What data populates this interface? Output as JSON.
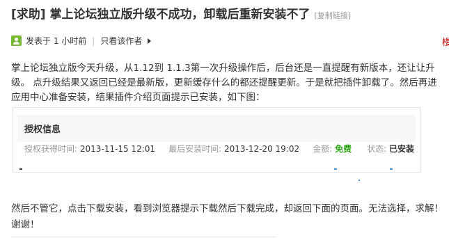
{
  "post": {
    "title": "[求助] 掌上论坛独立版升级不成功，卸载后重新安装不了",
    "copy_link_label": "[复制链接]",
    "meta": {
      "posted": "发表于 1 小时前",
      "author_only": "只看该作者",
      "edge_char": "楼"
    },
    "paragraph1": "掌上论坛独立版今天升级，从1.12到 1.1.3第一次升级操作后，后台还是一直提醒有新版本，还让让升级。  点升级结果又返回已经是最新版，更新缓存什么的都还提醒更新。于是就把插件卸载了。然后再进应用中心准备安装，结果插件介绍页面提示已安装，如下图：",
    "paragraph2": "然后不管它，点击下载安装，看到浏览器提示下载然后下载完成，却返回下面的页面。无法选择，求解！谢谢！"
  },
  "auth_card": {
    "title": "授权信息",
    "obtained_label": "授权获得时间:",
    "obtained_value": "2013-11-15 12:01",
    "last_install_label": "最后安装时间:",
    "last_install_value": "2013-12-20 19:02",
    "price_label": "金额:",
    "price_value": "免费",
    "status_label": "状态:",
    "status_value": "已安装"
  }
}
